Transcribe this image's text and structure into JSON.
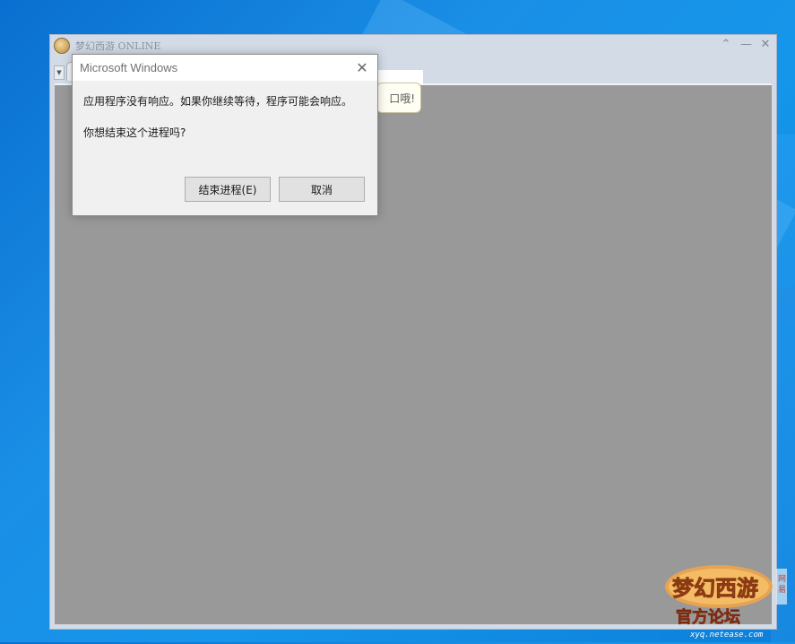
{
  "game_window": {
    "title": "梦幻西游 ONLINE",
    "controls": {
      "minimize": "⌃",
      "restore": "—",
      "close": "✕"
    }
  },
  "tooltip": {
    "text": "口哦!"
  },
  "dialog": {
    "title": "Microsoft Windows",
    "message": "应用程序没有响应。如果你继续等待，程序可能会响应。",
    "question": "你想结束这个进程吗?",
    "end_button": "结束进程(E)",
    "cancel_button": "取消",
    "close_glyph": "✕"
  },
  "watermark": {
    "logo_text": "梦幻西游",
    "subtitle": "官方论坛",
    "url": "xyq.netease.com",
    "side_text": "网易"
  },
  "colors": {
    "desktop": "#1590e6",
    "content_gray": "#999999",
    "dialog_bg": "#f0f0f0",
    "watermark_orange": "#e88a2c"
  }
}
